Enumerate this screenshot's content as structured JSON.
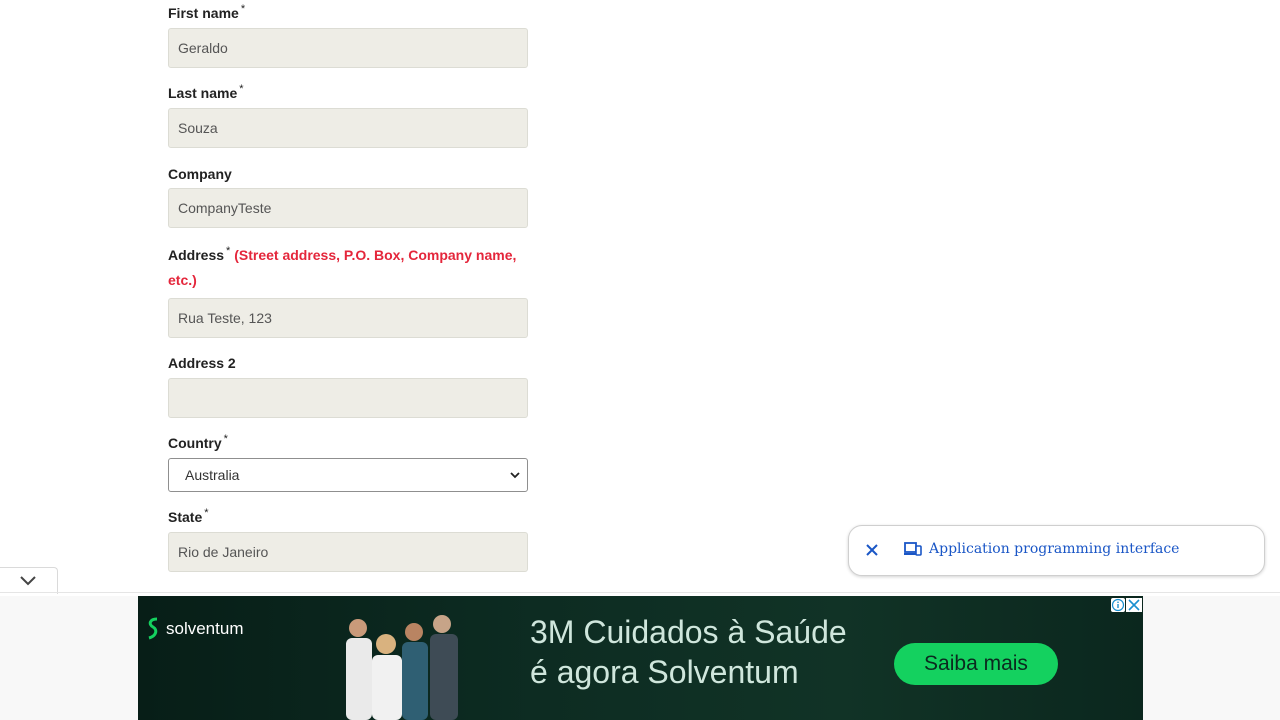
{
  "form": {
    "first_name": {
      "label": "First name",
      "required": "*",
      "value": "Geraldo"
    },
    "last_name": {
      "label": "Last name",
      "required": "*",
      "value": "Souza"
    },
    "company": {
      "label": "Company",
      "value": "CompanyTeste"
    },
    "address": {
      "label": "Address",
      "required": "*",
      "hint_line1": "(Street address, P.O. Box, Company name,",
      "hint_line2": "etc.)",
      "value": "Rua Teste, 123"
    },
    "address2": {
      "label": "Address 2",
      "value": ""
    },
    "country": {
      "label": "Country",
      "required": "*",
      "selected": "Australia"
    },
    "state": {
      "label": "State",
      "required": "*",
      "value": "Rio de Janeiro"
    }
  },
  "suggestion_popup": {
    "text": "Application programming interface",
    "close_icon": "close-icon",
    "device_icon": "devices-icon",
    "text_color": "#1a56c6"
  },
  "ad": {
    "brand": "solventum",
    "headline_line1": "3M Cuidados à Saúde",
    "headline_line2": "é agora Solventum",
    "cta": "Saiba mais",
    "cta_color": "#14d15f",
    "background": "#0d2c22"
  },
  "collapse_tab": {
    "icon": "chevron-down-icon"
  }
}
